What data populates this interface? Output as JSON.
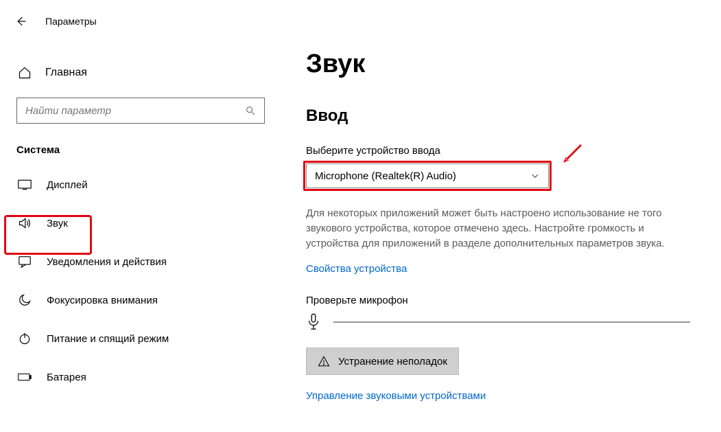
{
  "titlebar": {
    "title": "Параметры"
  },
  "sidebar": {
    "home": "Главная",
    "search_placeholder": "Найти параметр",
    "section": "Система",
    "items": [
      {
        "label": "Дисплей"
      },
      {
        "label": "Звук"
      },
      {
        "label": "Уведомления и действия"
      },
      {
        "label": "Фокусировка внимания"
      },
      {
        "label": "Питание и спящий режим"
      },
      {
        "label": "Батарея"
      }
    ]
  },
  "main": {
    "page_title": "Звук",
    "input_heading": "Ввод",
    "select_label": "Выберите устройство ввода",
    "select_value": "Microphone (Realtek(R) Audio)",
    "help_text": "Для некоторых приложений может быть настроено использование не того звукового устройства, которое отмечено здесь. Настройте громкость и устройства для приложений в разделе дополнительных параметров звука.",
    "device_props_link": "Свойства устройства",
    "mic_test_label": "Проверьте микрофон",
    "troubleshoot_btn": "Устранение неполадок",
    "manage_link": "Управление звуковыми устройствами"
  },
  "annotation": {
    "color": "#e30613"
  }
}
